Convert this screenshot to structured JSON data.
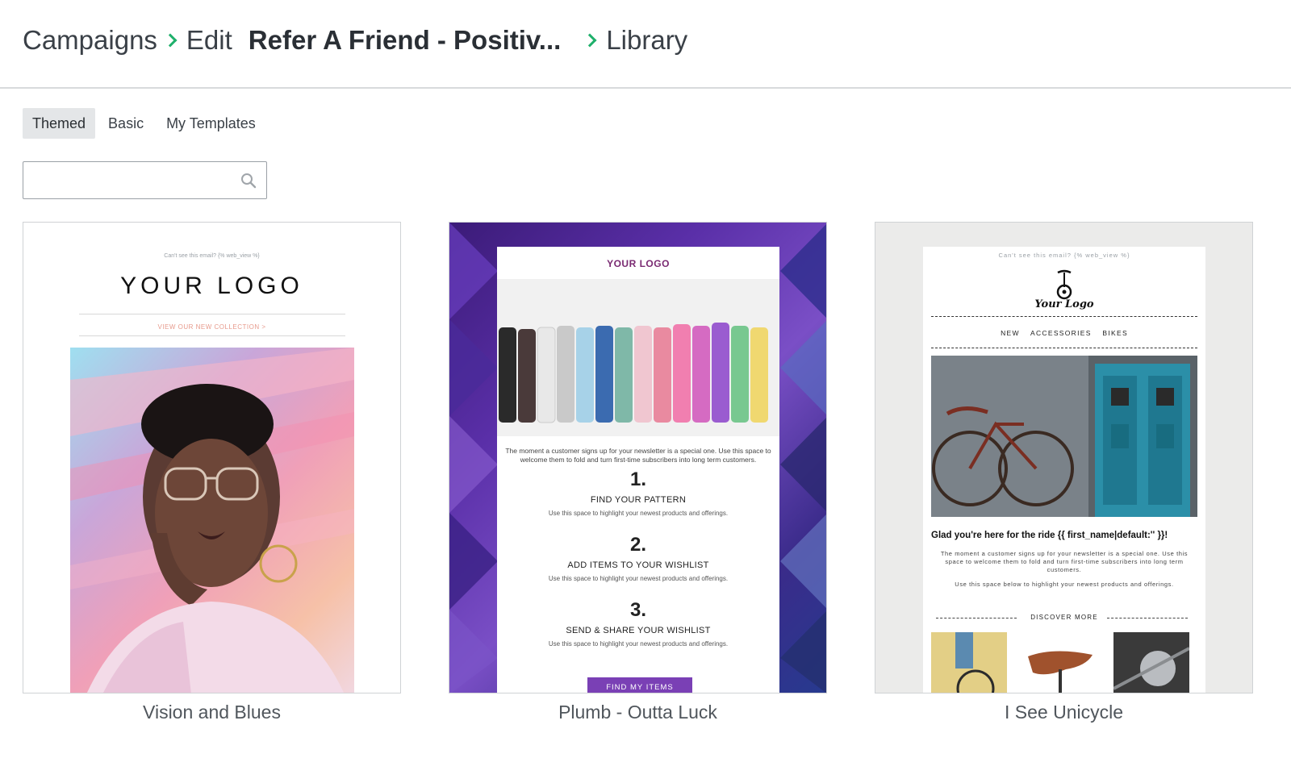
{
  "breadcrumb": {
    "items": [
      "Campaigns",
      "Edit",
      "Refer A Friend - Positiv...",
      "Library"
    ]
  },
  "tabs": [
    {
      "label": "Themed",
      "active": true
    },
    {
      "label": "Basic",
      "active": false
    },
    {
      "label": "My Templates",
      "active": false
    }
  ],
  "search": {
    "placeholder": "",
    "value": ""
  },
  "colors": {
    "accent": "#1fb06b",
    "purple_button": "#7a40b5"
  },
  "templates": [
    {
      "name": "Vision and Blues",
      "preview": {
        "preheader": "Can't see this email? {% web_view %}",
        "logo": "YOUR LOGO",
        "link": "VIEW OUR NEW COLLECTION >"
      }
    },
    {
      "name": "Plumb - Outta Luck",
      "preview": {
        "logo": "YOUR LOGO",
        "intro": "The moment a customer signs up for your newsletter is a special one. Use this space to welcome them to fold and turn first-time subscribers into long term customers.",
        "steps": [
          {
            "num": "1.",
            "title": "FIND YOUR PATTERN",
            "desc": "Use this space to highlight your newest products and offerings."
          },
          {
            "num": "2.",
            "title": "ADD ITEMS TO YOUR WISHLIST",
            "desc": "Use this space to highlight your newest products and offerings."
          },
          {
            "num": "3.",
            "title": "SEND & SHARE YOUR WISHLIST",
            "desc": "Use this space to highlight your newest products and offerings."
          }
        ],
        "button": "FIND MY ITEMS"
      }
    },
    {
      "name": "I See Unicycle",
      "preview": {
        "preheader": "Can't see this email? {% web_view %}",
        "logo": "Your Logo",
        "nav": "NEW ACCESSORIES BIKES",
        "greeting": "Glad you're here for the ride {{ first_name|default:'' }}!",
        "para1": "The moment a customer signs up for your newsletter is a special one. Use this space to welcome them to fold and turn first-time subscribers into long term customers.",
        "para2": "Use this space below to highlight your newest products and offerings.",
        "section": "DISCOVER MORE"
      }
    }
  ]
}
